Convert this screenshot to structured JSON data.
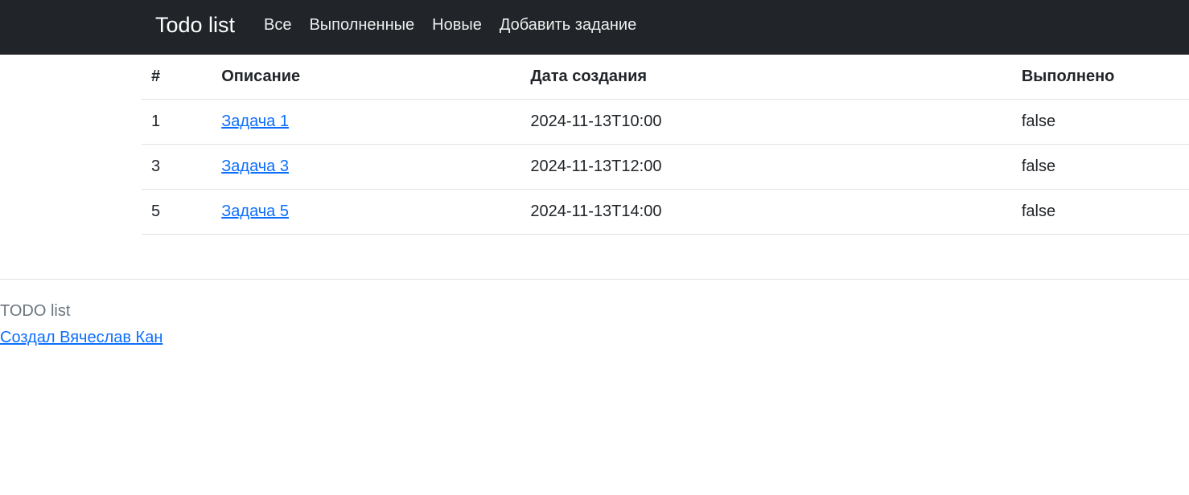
{
  "navbar": {
    "brand": "Todo list",
    "links": [
      {
        "label": "Все"
      },
      {
        "label": "Выполненные"
      },
      {
        "label": "Новые"
      },
      {
        "label": "Добавить задание"
      }
    ]
  },
  "table": {
    "headers": {
      "num": "#",
      "description": "Описание",
      "created": "Дата создания",
      "done": "Выполнено"
    },
    "rows": [
      {
        "num": "1",
        "description": "Задача 1",
        "created": "2024-11-13T10:00",
        "done": "false"
      },
      {
        "num": "3",
        "description": "Задача 3",
        "created": "2024-11-13T12:00",
        "done": "false"
      },
      {
        "num": "5",
        "description": "Задача 5",
        "created": "2024-11-13T14:00",
        "done": "false"
      }
    ]
  },
  "footer": {
    "title": "TODO list",
    "author_link": "Создал Вячеслав Кан"
  },
  "colors": {
    "navbar_bg": "#212529",
    "link": "#0d6efd",
    "muted": "#6c757d",
    "border": "#dee2e6"
  }
}
